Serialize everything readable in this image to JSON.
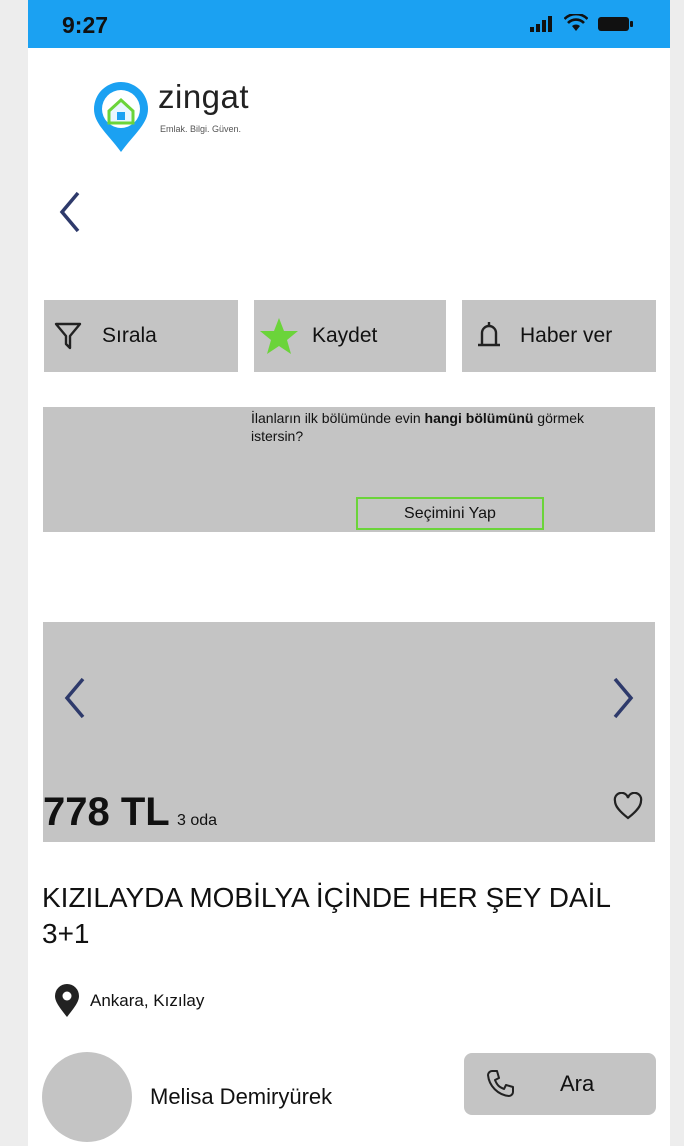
{
  "status": {
    "time": "9:27"
  },
  "brand": {
    "name": "zingat",
    "tagline": "Emlak. Bilgi. Güven."
  },
  "actions": {
    "sort_label": "Sırala",
    "save_label": "Kaydet",
    "notify_label": "Haber ver"
  },
  "banner": {
    "text_before": "İlanların ilk bölümünde evin ",
    "text_bold": "hangi bölümünü",
    "text_after": " görmek istersin?",
    "button_label": "Seçimini Yap"
  },
  "listing": {
    "price": "778 TL",
    "rooms": "3 oda",
    "title": "KIZILAYDA MOBİLYA İÇİNDE HER ŞEY DAİL 3+1",
    "location": "Ankara, Kızılay"
  },
  "agent": {
    "name": "Melisa Demiryürek",
    "call_label": "Ara"
  },
  "colors": {
    "statusbar": "#1ba1f2",
    "card_gray": "#c4c4c4",
    "accent_green": "#6bd43a",
    "nav_blue": "#2e3a6b"
  }
}
